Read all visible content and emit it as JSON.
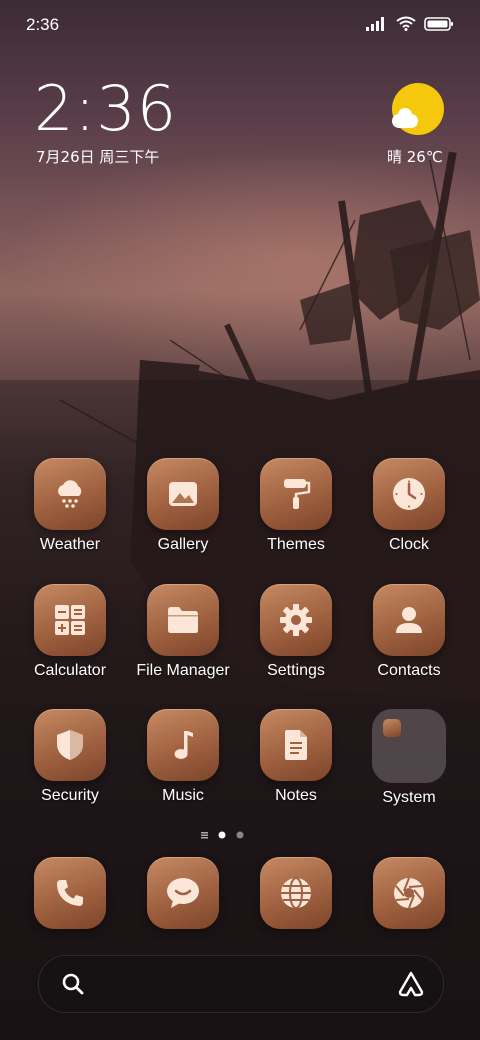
{
  "status_bar": {
    "time": "2:36",
    "icons": [
      "signal-icon",
      "wifi-icon",
      "battery-icon"
    ]
  },
  "clock_widget": {
    "time": "2:36",
    "date": "7月26日 周三下午"
  },
  "weather_widget": {
    "text": "晴 26℃",
    "icon": "sunny-partly-cloudy-icon"
  },
  "apps": [
    {
      "label": "Weather",
      "icon": "weather-cloud-snow-icon"
    },
    {
      "label": "Gallery",
      "icon": "gallery-image-icon"
    },
    {
      "label": "Themes",
      "icon": "paint-roller-icon"
    },
    {
      "label": "Clock",
      "icon": "clock-icon"
    },
    {
      "label": "Calculator",
      "icon": "calculator-icon"
    },
    {
      "label": "File Manager",
      "icon": "folder-icon"
    },
    {
      "label": "Settings",
      "icon": "gear-icon"
    },
    {
      "label": "Contacts",
      "icon": "person-icon"
    },
    {
      "label": "Security",
      "icon": "shield-icon"
    },
    {
      "label": "Music",
      "icon": "music-note-icon"
    },
    {
      "label": "Notes",
      "icon": "document-icon"
    },
    {
      "label": "System",
      "icon": "folder-group-icon"
    }
  ],
  "page_indicator": {
    "pages": 2,
    "current": 1
  },
  "dock": [
    {
      "icon": "phone-icon"
    },
    {
      "icon": "chat-bubble-icon"
    },
    {
      "icon": "globe-icon"
    },
    {
      "icon": "camera-aperture-icon"
    }
  ],
  "search_bar": {
    "icons": [
      "search-icon",
      "assistant-icon"
    ]
  },
  "colors": {
    "icon_tile": "#a66a48",
    "icon_glyph": "#fbe6d8",
    "sun": "#f6c80d"
  }
}
